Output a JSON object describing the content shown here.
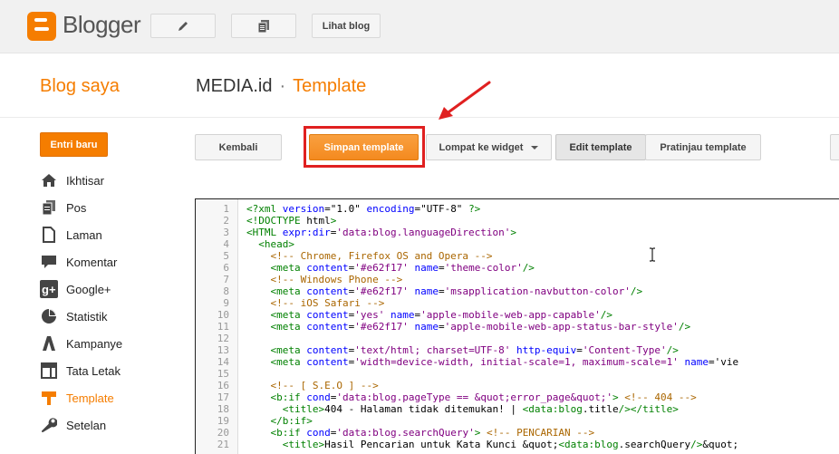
{
  "app": {
    "name": "Blogger"
  },
  "topbar": {
    "view_blog_label": "Lihat blog",
    "edit_icon": "pencil-icon",
    "posts_icon": "posts-icon"
  },
  "header": {
    "section_title": "Blog saya",
    "blog_name": "MEDIA.id",
    "separator": "·",
    "page": "Template"
  },
  "sidebar": {
    "new_post_label": "Entri baru",
    "items": [
      {
        "label": "Ikhtisar",
        "icon": "home-icon"
      },
      {
        "label": "Pos",
        "icon": "posts-icon"
      },
      {
        "label": "Laman",
        "icon": "page-icon"
      },
      {
        "label": "Komentar",
        "icon": "comment-icon"
      },
      {
        "label": "Google+",
        "icon": "google-plus-icon"
      },
      {
        "label": "Statistik",
        "icon": "stats-icon"
      },
      {
        "label": "Kampanye",
        "icon": "campaign-icon"
      },
      {
        "label": "Tata Letak",
        "icon": "layout-icon"
      },
      {
        "label": "Template",
        "icon": "template-icon",
        "active": true
      },
      {
        "label": "Setelan",
        "icon": "wrench-icon"
      }
    ]
  },
  "toolbar": {
    "back_label": "Kembali",
    "save_label": "Simpan template",
    "jump_label": "Lompat ke widget",
    "edit_label": "Edit template",
    "preview_label": "Pratinjau template"
  },
  "editor": {
    "line_numbers": [
      "1",
      "2",
      "3",
      "4",
      "5",
      "6",
      "7",
      "8",
      "9",
      "10",
      "11",
      "12",
      "13",
      "14",
      "15",
      "16",
      "17",
      "18",
      "19",
      "20",
      "21"
    ],
    "lines": [
      "<?xml version=\"1.0\" encoding=\"UTF-8\" ?>",
      "<!DOCTYPE html>",
      "<HTML expr:dir='data:blog.languageDirection'>",
      "  <head>",
      "    <!-- Chrome, Firefox OS and Opera -->",
      "    <meta content='#e62f17' name='theme-color'/>",
      "    <!-- Windows Phone -->",
      "    <meta content='#e62f17' name='msapplication-navbutton-color'/>",
      "    <!-- iOS Safari -->",
      "    <meta content='yes' name='apple-mobile-web-app-capable'/>",
      "    <meta content='#e62f17' name='apple-mobile-web-app-status-bar-style'/>",
      "",
      "    <meta content='text/html; charset=UTF-8' http-equiv='Content-Type'/>",
      "    <meta content='width=device-width, initial-scale=1, maximum-scale=1' name='vie",
      "",
      "    <!-- [ S.E.O ] -->",
      "    <b:if cond='data:blog.pageType == &quot;error_page&quot;'> <!-- 404 -->",
      "      <title>404 - Halaman tidak ditemukan! | <data:blog.title/></title>",
      "    </b:if>",
      "    <b:if cond='data:blog.searchQuery'> <!-- PENCARIAN -->",
      "      <title>Hasil Pencarian untuk Kata Kunci &quot;<data:blog.searchQuery/>&quot;"
    ]
  },
  "colors": {
    "brand": "#f57d00",
    "highlight": "#e02020"
  }
}
